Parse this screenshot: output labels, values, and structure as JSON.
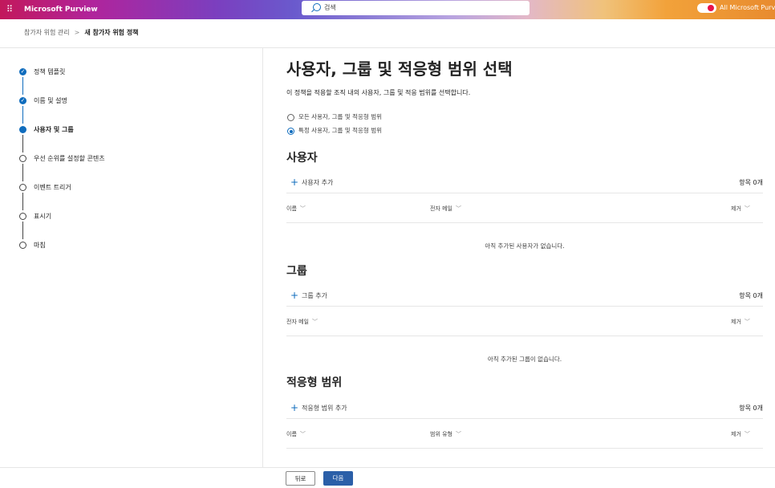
{
  "header": {
    "brand": "Microsoft Purview",
    "search_placeholder": "검색",
    "toggle_label": "All Microsoft Purview"
  },
  "breadcrumb": {
    "parent": "참가자 위험 관리",
    "separator": ">",
    "current": "새 참가자 위험 정책"
  },
  "steps": [
    {
      "label": "정책 템플릿",
      "state": "done"
    },
    {
      "label": "이름 및 설명",
      "state": "done"
    },
    {
      "label": "사용자 및 그룹",
      "state": "current"
    },
    {
      "label": "우선 순위를 설정할 콘텐츠",
      "state": "todo"
    },
    {
      "label": "이벤트 트리거",
      "state": "todo"
    },
    {
      "label": "표시기",
      "state": "todo"
    },
    {
      "label": "마침",
      "state": "todo"
    }
  ],
  "main": {
    "title": "사용자, 그룹 및 적응형 범위 선택",
    "description": "이 정책을 적용할 조직 내의 사용자, 그룹 및 적응 범위를 선택합니다.",
    "radio_options": [
      {
        "label": "모든 사용자, 그룹 및 적응형 범위",
        "selected": false
      },
      {
        "label": "특정 사용자, 그룹 및 적응형 범위",
        "selected": true
      }
    ],
    "users": {
      "heading": "사용자",
      "add_label": "사용자 추가",
      "count": "항목 0개",
      "columns": [
        "이름",
        "전자 메일",
        "제거"
      ],
      "empty": "아직 추가된 사용자가 없습니다."
    },
    "groups": {
      "heading": "그룹",
      "add_label": "그룹 추가",
      "count": "항목 0개",
      "columns": [
        "전자 메일",
        "제거"
      ],
      "empty": "아직 추가된 그룹이 없습니다."
    },
    "scopes": {
      "heading": "적응형 범위",
      "add_label": "적응형 범위 추가",
      "count": "항목 0개",
      "columns": [
        "이름",
        "범위 유형",
        "제거"
      ]
    }
  },
  "footer": {
    "back_label": "뒤로",
    "next_label": "다음"
  },
  "colors": {
    "accent": "#0f6cbd",
    "primary_button": "#2b5fa8",
    "toggle_knob": "#e8114a"
  }
}
